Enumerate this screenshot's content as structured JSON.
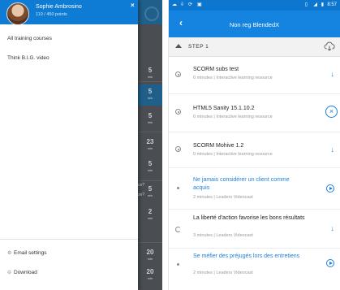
{
  "left_screen": {
    "drawer": {
      "user_name": "Sophie Ambrosino",
      "user_points": "110 / 450 points",
      "close_glyph": "×",
      "items": [
        {
          "label": "All training courses"
        },
        {
          "label": "Think B.I.G. video"
        }
      ],
      "footer": [
        {
          "label": "Email settings",
          "icon": "gear-icon"
        },
        {
          "label": "Download",
          "icon": "download-icon"
        }
      ]
    },
    "background": {
      "rows": [
        {
          "num": "5",
          "unit": "min"
        },
        {
          "num": "5",
          "unit": "min"
        },
        {
          "num": "5",
          "unit": "min"
        },
        {
          "num": "23",
          "unit": "min"
        },
        {
          "num": "5",
          "unit": "min"
        },
        {
          "num": "5",
          "unit": "min"
        },
        {
          "num": "2",
          "unit": "min"
        },
        {
          "num": "20",
          "unit": "min"
        },
        {
          "num": "20",
          "unit": "min"
        }
      ],
      "fragments": [
        "ce?",
        "ze?"
      ]
    },
    "colors": {
      "header": "#0e7bd4",
      "overlay": "#3b3e42"
    }
  },
  "right_screen": {
    "status_time": "8:57",
    "app_title": "Non reg BlendedX",
    "step_label": "STEP 1",
    "items": [
      {
        "title": "SCORM subs test",
        "meta": "0 minutes | Interactive learning resource",
        "lead": "ring",
        "action": "download",
        "link": false
      },
      {
        "title": "HTML5 Sanity 15.1.10.2",
        "meta": "0 minutes | Interactive learning resource",
        "lead": "ring",
        "action": "cancel",
        "link": false
      },
      {
        "title": "SCORM Mohive 1.2",
        "meta": "0 minutes | Interactive learning resource",
        "lead": "ring",
        "action": "download",
        "link": false
      },
      {
        "title": "Ne jamais considérer un client comme acquis",
        "meta": "2 minutes | Leaders Videocast",
        "lead": "dot",
        "action": "play",
        "link": true
      },
      {
        "title": "La liberté d'action favorise les bons résultats",
        "meta": "3 minutes | Leaders Videocast",
        "lead": "clock",
        "action": "download",
        "link": false
      },
      {
        "title": "Se méfier des préjugés lors des entretiens",
        "meta": "2 minutes | Leaders Videocast",
        "lead": "dot",
        "action": "play",
        "link": true
      }
    ],
    "colors": {
      "statusbar": "#0d77cf",
      "appbar": "#1584e0",
      "accent": "#1e7fd8"
    }
  }
}
